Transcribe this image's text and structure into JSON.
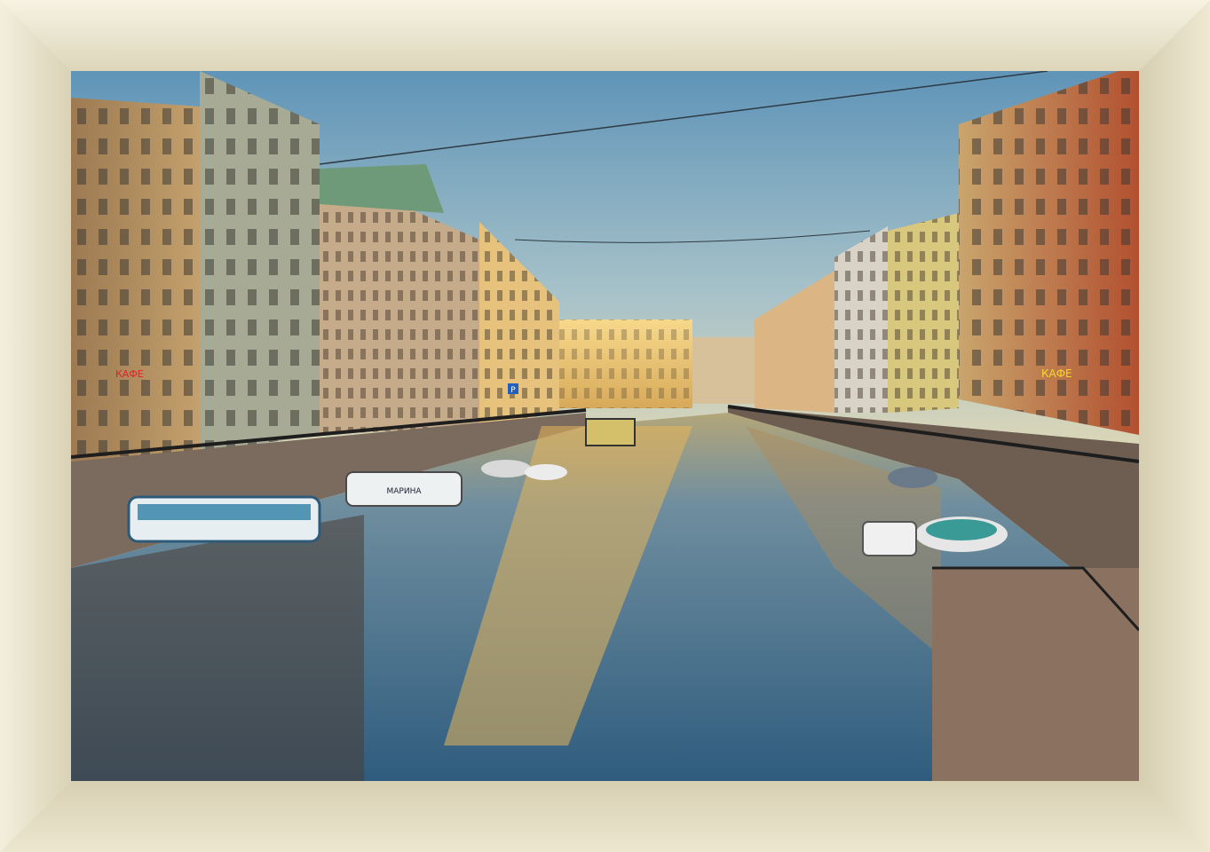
{
  "image": {
    "subject": "canal-cityscape",
    "frame_color": "#e9e3cb",
    "sky_top": "#5f94b8",
    "sky_bottom": "#e9dcb2",
    "water_color": "#3c6a8a"
  },
  "signs": {
    "kafe_left": "КАФЕ",
    "kafe_right": "КАФЕ",
    "parking": "P",
    "boat_name": "МАРИНА"
  }
}
